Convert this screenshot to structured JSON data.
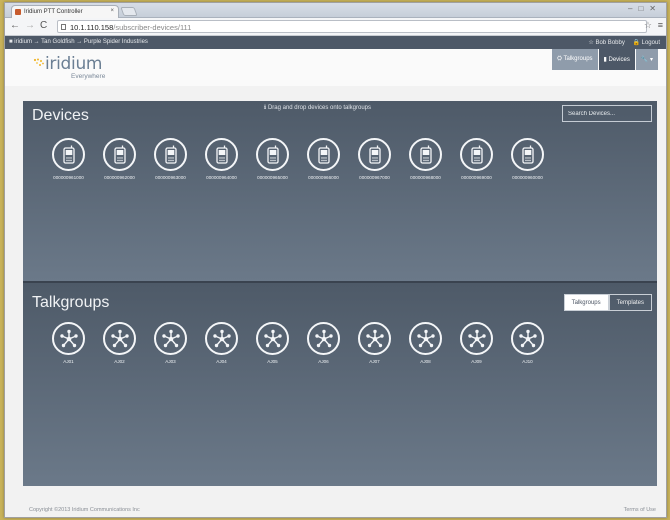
{
  "browser": {
    "tab_title": "Iridium PTT Controller",
    "tab_close": "×",
    "url_host": "10.1.110.158",
    "url_path": "/subscriber-devices/111"
  },
  "breadcrumb": {
    "text": "■ iridium → Tan Goldfish → Purple Spider Industries",
    "user": "☆ Bob Bobby",
    "logout": "🔒 Logout"
  },
  "brand": {
    "name": "iridium",
    "tagline": "Everywhere"
  },
  "nav": {
    "talkgroups": "⛭ Talkgroups",
    "devices": "▮ Devices",
    "tools": "🔧 ▾"
  },
  "devices": {
    "title": "Devices",
    "hint": "ℹ Drag and drop devices onto talkgroups",
    "search_placeholder": "Search Devices...",
    "items": [
      "000000961000",
      "000000962000",
      "000000963000",
      "000000964000",
      "000000965000",
      "000000966000",
      "000000967000",
      "000000968000",
      "000000969000",
      "000000960000"
    ]
  },
  "talkgroups": {
    "title": "Talkgroups",
    "toggle_talkgroups": "Talkgroups",
    "toggle_templates": "Templates",
    "items": [
      "AJ01",
      "AJ02",
      "AJ03",
      "AJ04",
      "AJ05",
      "AJ06",
      "AJ07",
      "AJ08",
      "AJ09",
      "AJ10"
    ]
  },
  "footer": {
    "copyright": "Copyright ©2013 Iridium Communications Inc",
    "terms": "Terms of Use"
  },
  "colors": {
    "panel": "#5e6b7a",
    "header_bar": "#4d5867",
    "nav_button": "#8f9cab",
    "logo_dots": "#f0b429"
  }
}
